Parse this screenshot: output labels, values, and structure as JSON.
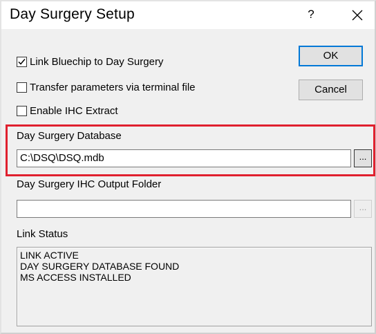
{
  "window": {
    "title": "Day Surgery Setup",
    "help_label": "?",
    "close_label": "✕"
  },
  "options": {
    "link_bluechip": {
      "label": "Link Bluechip to Day Surgery",
      "checked": true
    },
    "transfer_params": {
      "label": "Transfer parameters via terminal file",
      "checked": false
    },
    "enable_ihc": {
      "label": "Enable IHC Extract",
      "checked": false
    }
  },
  "buttons": {
    "ok_label": "OK",
    "cancel_label": "Cancel",
    "browse_label": "..."
  },
  "database": {
    "label": "Day Surgery Database",
    "value": "C:\\DSQ\\DSQ.mdb"
  },
  "ihc_output": {
    "label": "Day Surgery IHC Output Folder",
    "value": ""
  },
  "link_status": {
    "label": "Link Status",
    "lines": [
      "LINK ACTIVE",
      "DAY SURGERY DATABASE FOUND",
      "MS ACCESS INSTALLED"
    ]
  },
  "colors": {
    "highlight": "#e0202e",
    "default_button_border": "#0078d7",
    "dialog_background": "#f0f0f0"
  }
}
